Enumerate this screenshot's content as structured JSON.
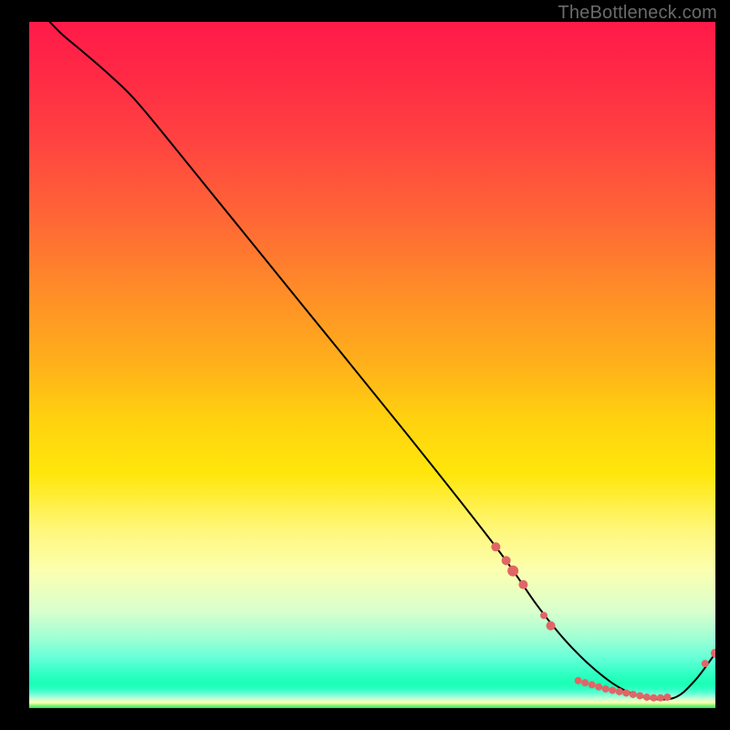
{
  "watermark": "TheBottleneck.com",
  "chart_data": {
    "type": "line",
    "title": "",
    "xlabel": "",
    "ylabel": "",
    "xlim": [
      0,
      100
    ],
    "ylim": [
      0,
      100
    ],
    "grid": false,
    "legend": false,
    "series": [
      {
        "name": "bottleneck-curve",
        "x": [
          3,
          5,
          8,
          12,
          16,
          25,
          40,
          55,
          68,
          74,
          78,
          82,
          86,
          90,
          94,
          97,
          100
        ],
        "y": [
          100,
          98,
          95.5,
          92,
          88,
          77,
          58.5,
          40,
          23.5,
          15,
          10,
          6,
          3,
          1.5,
          1.5,
          4,
          8
        ]
      }
    ],
    "points": {
      "name": "highlighted-points",
      "color": "#e06666",
      "items": [
        {
          "x": 68.0,
          "y": 23.5,
          "r": 5
        },
        {
          "x": 69.5,
          "y": 21.5,
          "r": 5
        },
        {
          "x": 70.5,
          "y": 20.0,
          "r": 6
        },
        {
          "x": 72.0,
          "y": 18.0,
          "r": 5
        },
        {
          "x": 75.0,
          "y": 13.5,
          "r": 4
        },
        {
          "x": 76.0,
          "y": 12.0,
          "r": 5
        },
        {
          "x": 80.0,
          "y": 4.0,
          "r": 4
        },
        {
          "x": 81.0,
          "y": 3.7,
          "r": 4
        },
        {
          "x": 82.0,
          "y": 3.4,
          "r": 4
        },
        {
          "x": 83.0,
          "y": 3.1,
          "r": 4
        },
        {
          "x": 84.0,
          "y": 2.8,
          "r": 4
        },
        {
          "x": 85.0,
          "y": 2.6,
          "r": 4
        },
        {
          "x": 86.0,
          "y": 2.4,
          "r": 4
        },
        {
          "x": 87.0,
          "y": 2.2,
          "r": 4
        },
        {
          "x": 88.0,
          "y": 2.0,
          "r": 4
        },
        {
          "x": 89.0,
          "y": 1.8,
          "r": 4
        },
        {
          "x": 90.0,
          "y": 1.6,
          "r": 4
        },
        {
          "x": 91.0,
          "y": 1.5,
          "r": 4
        },
        {
          "x": 92.0,
          "y": 1.5,
          "r": 4
        },
        {
          "x": 93.0,
          "y": 1.6,
          "r": 4
        },
        {
          "x": 98.5,
          "y": 6.5,
          "r": 4
        },
        {
          "x": 100.0,
          "y": 8.0,
          "r": 5
        }
      ]
    }
  }
}
